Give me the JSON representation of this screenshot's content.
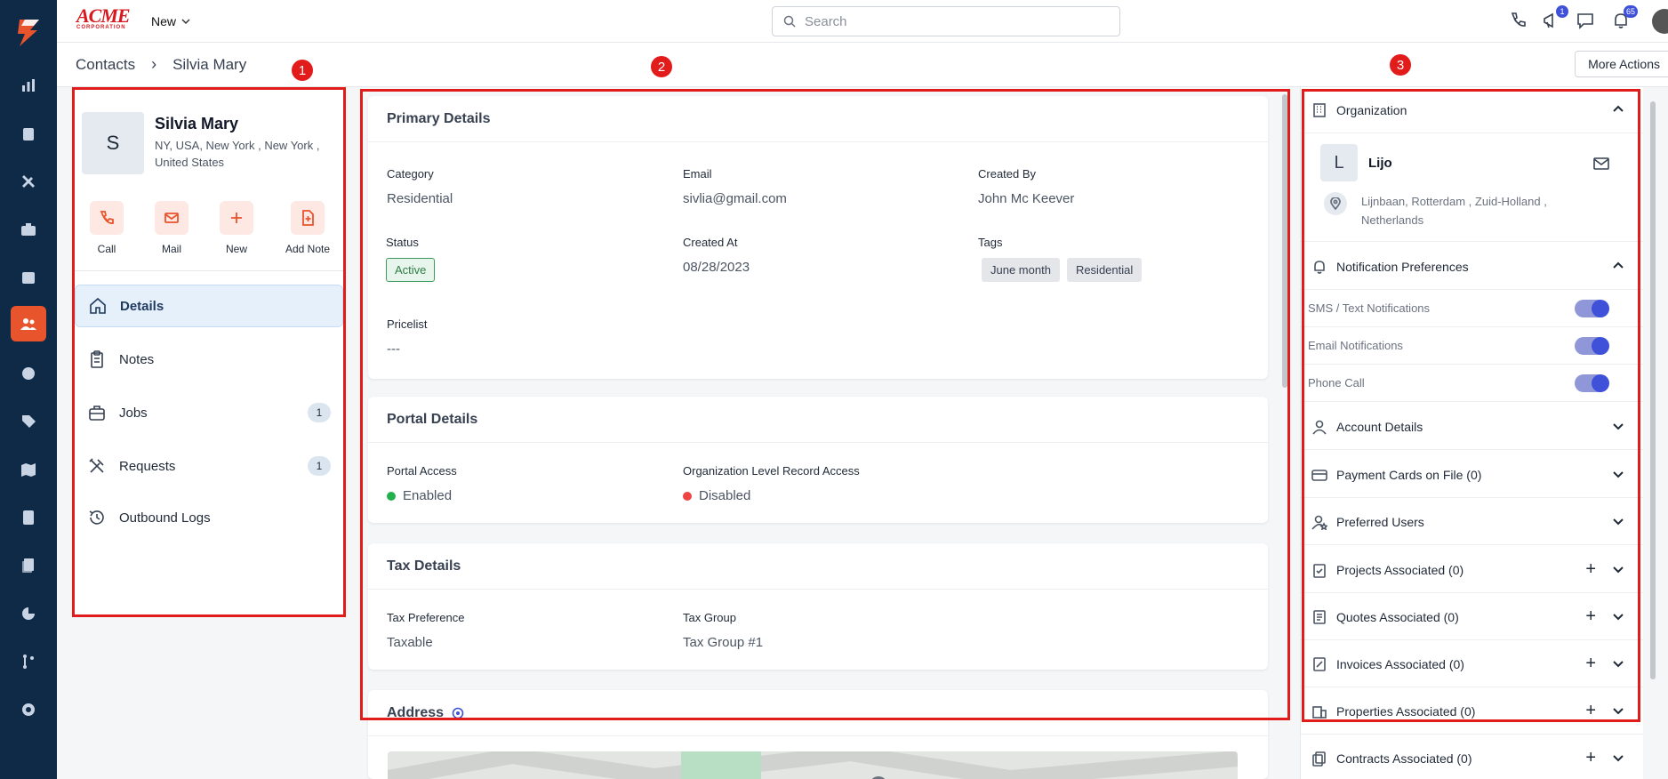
{
  "brand": {
    "name": "ACME",
    "sub": "CORPORATION",
    "accent": "#e8542b"
  },
  "topbar": {
    "new_label": "New",
    "search_placeholder": "Search",
    "announce_badge": "1",
    "notif_badge": "65"
  },
  "breadcrumb": {
    "root": "Contacts",
    "separator": "›",
    "current": "Silvia Mary"
  },
  "more_actions": "More Actions",
  "markers": [
    "1",
    "2",
    "3"
  ],
  "contact": {
    "initial": "S",
    "name": "Silvia Mary",
    "address": "NY, USA, New York , New York , United States"
  },
  "quick_actions": [
    {
      "label": "Call",
      "icon": "phone-icon"
    },
    {
      "label": "Mail",
      "icon": "mail-icon"
    },
    {
      "label": "New",
      "icon": "plus-icon"
    },
    {
      "label": "Add Note",
      "icon": "add-note-icon"
    }
  ],
  "nav": [
    {
      "label": "Details",
      "icon": "home-icon",
      "active": true
    },
    {
      "label": "Notes",
      "icon": "clipboard-icon"
    },
    {
      "label": "Jobs",
      "icon": "briefcase-icon",
      "count": "1"
    },
    {
      "label": "Requests",
      "icon": "tools-icon",
      "count": "1"
    },
    {
      "label": "Outbound Logs",
      "icon": "history-icon"
    }
  ],
  "primary": {
    "title": "Primary Details",
    "category_label": "Category",
    "category": "Residential",
    "email_label": "Email",
    "email": "sivlia@gmail.com",
    "created_by_label": "Created By",
    "created_by": "John Mc Keever",
    "status_label": "Status",
    "status": "Active",
    "created_at_label": "Created At",
    "created_at": "08/28/2023",
    "tags_label": "Tags",
    "tags": [
      "June month",
      "Residential"
    ],
    "pricelist_label": "Pricelist",
    "pricelist": "---"
  },
  "portal": {
    "title": "Portal Details",
    "access_label": "Portal Access",
    "access": "Enabled",
    "org_label": "Organization Level Record Access",
    "org": "Disabled",
    "enabled_color": "#22b14c",
    "disabled_color": "#ef4444"
  },
  "tax": {
    "title": "Tax Details",
    "pref_label": "Tax Preference",
    "pref": "Taxable",
    "group_label": "Tax Group",
    "group": "Tax Group #1"
  },
  "address_title": "Address",
  "right": {
    "organization_title": "Organization",
    "org_initial": "L",
    "org_name": "Lijo",
    "org_address": "Lijnbaan, Rotterdam , Zuid-Holland , Netherlands",
    "notif_title": "Notification Preferences",
    "toggles": [
      {
        "label": "SMS / Text Notifications",
        "on": true
      },
      {
        "label": "Email Notifications",
        "on": true
      },
      {
        "label": "Phone Call",
        "on": true
      }
    ],
    "sections": [
      {
        "label": "Account Details",
        "icon": "user-icon"
      },
      {
        "label": "Payment Cards on File (0)",
        "icon": "card-icon"
      },
      {
        "label": "Preferred Users",
        "icon": "user-star-icon"
      },
      {
        "label": "Projects Associated (0)",
        "icon": "clipboard-check-icon",
        "add": "+"
      },
      {
        "label": "Quotes Associated (0)",
        "icon": "document-icon",
        "add": "+"
      },
      {
        "label": "Invoices Associated (0)",
        "icon": "invoice-icon",
        "add": "+"
      },
      {
        "label": "Properties Associated (0)",
        "icon": "building-icon",
        "add": "+"
      },
      {
        "label": "Contracts Associated (0)",
        "icon": "copy-icon",
        "add": "+"
      }
    ]
  }
}
